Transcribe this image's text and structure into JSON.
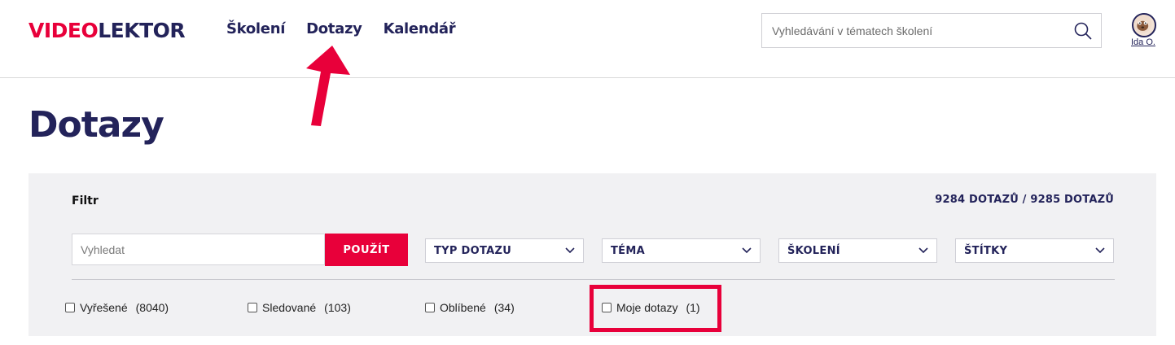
{
  "brand": {
    "part1": "VIDEO",
    "part2": "LEKTOR"
  },
  "nav": [
    "Školení",
    "Dotazy",
    "Kalendář"
  ],
  "header_search": {
    "placeholder": "Vyhledávání v tématech školení"
  },
  "user": {
    "name": "Ida O."
  },
  "page": {
    "title": "Dotazy"
  },
  "filter": {
    "label": "Filtr",
    "count": "9284 DOTAZŮ / 9285 DOTAZŮ",
    "search_placeholder": "Vyhledat",
    "apply_label": "POUŽÍT",
    "dropdowns": [
      "TYP DOTAZU",
      "TÉMA",
      "ŠKOLENÍ",
      "ŠTÍTKY"
    ],
    "checkboxes": [
      {
        "label": "Vyřešené",
        "count": "(8040)"
      },
      {
        "label": "Sledované",
        "count": "(103)"
      },
      {
        "label": "Oblíbené",
        "count": "(34)"
      },
      {
        "label": "Moje dotazy",
        "count": "(1)"
      }
    ]
  },
  "colors": {
    "accent": "#e8003a",
    "navy": "#23235a",
    "panel": "#f1f1f3"
  }
}
